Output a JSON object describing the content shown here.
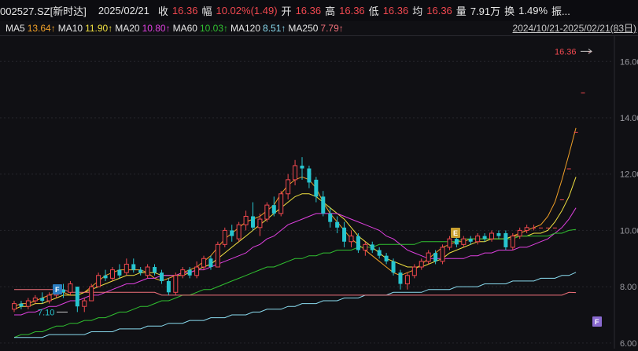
{
  "header": {
    "code": "002527.SZ[新时达]",
    "date": "2025/02/21",
    "close_label": "收",
    "close_value": "16.36",
    "change_label": "幅",
    "change_value": "10.02%(1.49)",
    "open_label": "开",
    "open_value": "16.36",
    "high_label": "高",
    "high_value": "16.36",
    "low_label": "低",
    "low_value": "16.36",
    "avg_label": "均",
    "avg_value": "16.36",
    "vol_label": "量",
    "vol_value": "7.91万",
    "turnover_label": "换",
    "turnover_value": "1.49%",
    "more_label": "振..."
  },
  "ma_legend": [
    {
      "label": "MA5",
      "value": "13.64↑",
      "color": "#f0a028"
    },
    {
      "label": "MA10",
      "value": "11.90↑",
      "color": "#f0e040"
    },
    {
      "label": "MA20",
      "value": "10.80↑",
      "color": "#e040e0"
    },
    {
      "label": "MA60",
      "value": "10.03↑",
      "color": "#30c030"
    },
    {
      "label": "MA120",
      "value": "8.51↑",
      "color": "#8adcf0"
    },
    {
      "label": "MA250",
      "value": "7.79↑",
      "color": "#f0707a"
    }
  ],
  "date_range": "2024/10/21-2025/02/21(83日)",
  "colors": {
    "up": "#f0484f",
    "down": "#27c5cf",
    "grid": "#2a2a30",
    "axis_text": "#9a9aa0"
  },
  "y_axis": {
    "ticks": [
      "16.00",
      "14.00",
      "12.00",
      "10.00",
      "8.00",
      "6.00"
    ],
    "min": 5.8,
    "max": 16.9
  },
  "annotations": {
    "last_price": "16.36",
    "low_price": "7.10",
    "marker_f1": "F",
    "marker_e": "E",
    "marker_f2": "F"
  },
  "chart_data": {
    "type": "candlestick",
    "ylim": [
      5.8,
      16.9
    ],
    "candles": [
      {
        "o": 7.2,
        "c": 7.4,
        "h": 7.5,
        "l": 7.1
      },
      {
        "o": 7.4,
        "c": 7.3,
        "h": 7.5,
        "l": 7.2
      },
      {
        "o": 7.3,
        "c": 7.5,
        "h": 7.6,
        "l": 7.2
      },
      {
        "o": 7.5,
        "c": 7.6,
        "h": 7.7,
        "l": 7.4
      },
      {
        "o": 7.6,
        "c": 7.5,
        "h": 7.8,
        "l": 7.4
      },
      {
        "o": 7.5,
        "c": 7.7,
        "h": 7.8,
        "l": 7.4
      },
      {
        "o": 7.7,
        "c": 7.9,
        "h": 8.0,
        "l": 7.6
      },
      {
        "o": 7.9,
        "c": 7.8,
        "h": 8.1,
        "l": 7.6
      },
      {
        "o": 7.8,
        "c": 8.1,
        "h": 8.2,
        "l": 7.7
      },
      {
        "o": 8.0,
        "c": 7.3,
        "h": 8.0,
        "l": 7.1
      },
      {
        "o": 7.3,
        "c": 7.5,
        "h": 7.6,
        "l": 7.1
      },
      {
        "o": 7.5,
        "c": 8.0,
        "h": 8.1,
        "l": 7.5
      },
      {
        "o": 8.0,
        "c": 8.4,
        "h": 8.5,
        "l": 8.0
      },
      {
        "o": 8.4,
        "c": 8.3,
        "h": 8.6,
        "l": 8.2
      },
      {
        "o": 8.3,
        "c": 8.6,
        "h": 8.7,
        "l": 8.2
      },
      {
        "o": 8.6,
        "c": 8.4,
        "h": 8.8,
        "l": 8.3
      },
      {
        "o": 8.5,
        "c": 8.8,
        "h": 9.0,
        "l": 8.4
      },
      {
        "o": 8.8,
        "c": 8.6,
        "h": 9.0,
        "l": 8.5
      },
      {
        "o": 8.6,
        "c": 8.5,
        "h": 8.7,
        "l": 8.4
      },
      {
        "o": 8.4,
        "c": 8.7,
        "h": 8.8,
        "l": 8.3
      },
      {
        "o": 8.7,
        "c": 8.5,
        "h": 8.8,
        "l": 8.4
      },
      {
        "o": 8.5,
        "c": 8.2,
        "h": 8.6,
        "l": 8.1
      },
      {
        "o": 8.2,
        "c": 7.8,
        "h": 8.3,
        "l": 7.7
      },
      {
        "o": 7.8,
        "c": 8.4,
        "h": 8.5,
        "l": 7.7
      },
      {
        "o": 8.4,
        "c": 8.6,
        "h": 8.7,
        "l": 8.3
      },
      {
        "o": 8.6,
        "c": 8.4,
        "h": 8.7,
        "l": 8.3
      },
      {
        "o": 8.4,
        "c": 8.7,
        "h": 8.9,
        "l": 8.3
      },
      {
        "o": 8.7,
        "c": 9.0,
        "h": 9.1,
        "l": 8.6
      },
      {
        "o": 9.0,
        "c": 8.7,
        "h": 9.1,
        "l": 8.6
      },
      {
        "o": 8.7,
        "c": 9.5,
        "h": 9.6,
        "l": 8.7
      },
      {
        "o": 9.5,
        "c": 10.0,
        "h": 10.1,
        "l": 9.4
      },
      {
        "o": 10.0,
        "c": 9.8,
        "h": 10.2,
        "l": 9.6
      },
      {
        "o": 9.7,
        "c": 10.2,
        "h": 10.3,
        "l": 9.6
      },
      {
        "o": 10.2,
        "c": 10.5,
        "h": 10.7,
        "l": 10.0
      },
      {
        "o": 10.5,
        "c": 10.1,
        "h": 11.0,
        "l": 10.0
      },
      {
        "o": 10.1,
        "c": 10.4,
        "h": 10.6,
        "l": 9.8
      },
      {
        "o": 10.4,
        "c": 10.9,
        "h": 11.0,
        "l": 10.3
      },
      {
        "o": 10.9,
        "c": 10.6,
        "h": 11.2,
        "l": 10.5
      },
      {
        "o": 10.6,
        "c": 11.3,
        "h": 11.4,
        "l": 10.5
      },
      {
        "o": 11.3,
        "c": 11.8,
        "h": 12.0,
        "l": 11.1
      },
      {
        "o": 11.8,
        "c": 12.3,
        "h": 12.5,
        "l": 11.6
      },
      {
        "o": 12.3,
        "c": 12.2,
        "h": 12.6,
        "l": 11.8
      },
      {
        "o": 12.2,
        "c": 11.7,
        "h": 12.3,
        "l": 11.5
      },
      {
        "o": 11.8,
        "c": 11.2,
        "h": 11.9,
        "l": 11.0
      },
      {
        "o": 11.2,
        "c": 10.6,
        "h": 11.4,
        "l": 10.5
      },
      {
        "o": 10.6,
        "c": 10.3,
        "h": 10.8,
        "l": 10.1
      },
      {
        "o": 10.3,
        "c": 10.1,
        "h": 10.5,
        "l": 9.9
      },
      {
        "o": 10.1,
        "c": 9.6,
        "h": 10.3,
        "l": 9.4
      },
      {
        "o": 9.6,
        "c": 9.8,
        "h": 10.0,
        "l": 9.4
      },
      {
        "o": 9.8,
        "c": 9.3,
        "h": 9.9,
        "l": 9.2
      },
      {
        "o": 9.3,
        "c": 9.5,
        "h": 9.6,
        "l": 9.1
      },
      {
        "o": 9.5,
        "c": 9.3,
        "h": 9.6,
        "l": 9.2
      },
      {
        "o": 9.3,
        "c": 9.1,
        "h": 9.4,
        "l": 9.0
      },
      {
        "o": 9.1,
        "c": 8.9,
        "h": 9.2,
        "l": 8.8
      },
      {
        "o": 8.9,
        "c": 8.5,
        "h": 9.0,
        "l": 8.4
      },
      {
        "o": 8.5,
        "c": 8.1,
        "h": 8.6,
        "l": 7.9
      },
      {
        "o": 8.1,
        "c": 8.4,
        "h": 8.5,
        "l": 7.9
      },
      {
        "o": 8.4,
        "c": 8.7,
        "h": 8.8,
        "l": 8.3
      },
      {
        "o": 8.7,
        "c": 8.9,
        "h": 9.0,
        "l": 8.6
      },
      {
        "o": 8.9,
        "c": 9.2,
        "h": 9.3,
        "l": 8.8
      },
      {
        "o": 9.2,
        "c": 8.9,
        "h": 9.3,
        "l": 8.8
      },
      {
        "o": 8.9,
        "c": 9.4,
        "h": 9.5,
        "l": 8.8
      },
      {
        "o": 9.4,
        "c": 9.7,
        "h": 9.8,
        "l": 9.3
      },
      {
        "o": 9.7,
        "c": 9.5,
        "h": 9.8,
        "l": 9.4
      },
      {
        "o": 9.5,
        "c": 9.7,
        "h": 9.8,
        "l": 9.4
      },
      {
        "o": 9.7,
        "c": 9.6,
        "h": 9.8,
        "l": 9.5
      },
      {
        "o": 9.6,
        "c": 9.8,
        "h": 9.9,
        "l": 9.5
      },
      {
        "o": 9.8,
        "c": 9.7,
        "h": 9.9,
        "l": 9.6
      },
      {
        "o": 9.7,
        "c": 9.9,
        "h": 10.0,
        "l": 9.6
      },
      {
        "o": 9.9,
        "c": 9.8,
        "h": 10.0,
        "l": 9.7
      },
      {
        "o": 9.9,
        "c": 9.4,
        "h": 10.0,
        "l": 9.3
      },
      {
        "o": 9.4,
        "c": 9.8,
        "h": 9.9,
        "l": 9.3
      },
      {
        "o": 9.8,
        "c": 10.0,
        "h": 10.1,
        "l": 9.7
      },
      {
        "o": 10.0,
        "c": 10.1,
        "h": 10.2,
        "l": 9.9
      },
      {
        "o": 10.1,
        "c": 10.1,
        "h": 10.2,
        "l": 10.0
      },
      {
        "o": 10.1,
        "c": 10.1,
        "h": 10.1,
        "l": 10.1
      },
      {
        "o": 10.1,
        "c": 10.1,
        "h": 10.1,
        "l": 10.1
      },
      {
        "o": 10.1,
        "c": 10.1,
        "h": 10.1,
        "l": 10.1
      },
      {
        "o": 11.1,
        "c": 11.1,
        "h": 11.1,
        "l": 11.1
      },
      {
        "o": 12.2,
        "c": 12.2,
        "h": 12.2,
        "l": 12.2
      },
      {
        "o": 13.5,
        "c": 13.5,
        "h": 13.5,
        "l": 13.5
      },
      {
        "o": 14.9,
        "c": 14.9,
        "h": 14.9,
        "l": 14.9
      },
      {
        "o": 16.36,
        "c": 16.36,
        "h": 16.36,
        "l": 16.36
      }
    ],
    "ma_lines": {
      "MA5": [
        7.3,
        7.4,
        7.4,
        7.5,
        7.6,
        7.7,
        7.8,
        7.8,
        7.7,
        7.7,
        7.8,
        8.0,
        8.2,
        8.4,
        8.5,
        8.6,
        8.6,
        8.6,
        8.6,
        8.5,
        8.3,
        8.2,
        8.3,
        8.4,
        8.5,
        8.6,
        8.7,
        8.9,
        9.1,
        9.4,
        9.7,
        9.9,
        10.1,
        10.3,
        10.4,
        10.5,
        10.7,
        10.9,
        11.3,
        11.6,
        11.8,
        11.9,
        11.8,
        11.5,
        11.0,
        10.6,
        10.3,
        10.0,
        9.7,
        9.5,
        9.3,
        9.1,
        8.9,
        8.7,
        8.5,
        8.4,
        8.5,
        8.6,
        8.8,
        9.0,
        9.2,
        9.4,
        9.5,
        9.6,
        9.6,
        9.7,
        9.7,
        9.7,
        9.7,
        9.7,
        9.7,
        9.8,
        9.9,
        10.0,
        10.1,
        10.2,
        10.5,
        11.0,
        11.8,
        12.7,
        13.64
      ],
      "MA10": [
        7.2,
        7.3,
        7.3,
        7.4,
        7.4,
        7.5,
        7.6,
        7.7,
        7.7,
        7.7,
        7.8,
        7.9,
        8.0,
        8.1,
        8.2,
        8.3,
        8.4,
        8.4,
        8.5,
        8.5,
        8.5,
        8.4,
        8.4,
        8.4,
        8.4,
        8.5,
        8.6,
        8.7,
        8.8,
        9.0,
        9.2,
        9.4,
        9.6,
        9.8,
        10.0,
        10.2,
        10.4,
        10.6,
        10.8,
        11.0,
        11.2,
        11.3,
        11.3,
        11.2,
        11.0,
        10.8,
        10.6,
        10.4,
        10.1,
        9.8,
        9.6,
        9.4,
        9.2,
        9.0,
        8.9,
        8.8,
        8.7,
        8.7,
        8.7,
        8.8,
        8.9,
        9.0,
        9.2,
        9.3,
        9.4,
        9.5,
        9.6,
        9.6,
        9.7,
        9.7,
        9.7,
        9.8,
        9.8,
        9.8,
        9.9,
        9.9,
        10.0,
        10.3,
        10.7,
        11.2,
        11.9
      ],
      "MA20": [
        7.0,
        7.0,
        7.1,
        7.1,
        7.2,
        7.3,
        7.3,
        7.4,
        7.5,
        7.5,
        7.6,
        7.7,
        7.7,
        7.8,
        7.9,
        8.0,
        8.1,
        8.1,
        8.2,
        8.3,
        8.3,
        8.4,
        8.4,
        8.4,
        8.5,
        8.5,
        8.6,
        8.6,
        8.7,
        8.8,
        8.9,
        9.0,
        9.1,
        9.2,
        9.4,
        9.5,
        9.7,
        9.8,
        10.0,
        10.2,
        10.3,
        10.4,
        10.5,
        10.6,
        10.6,
        10.6,
        10.6,
        10.5,
        10.4,
        10.3,
        10.2,
        10.1,
        10.0,
        9.8,
        9.7,
        9.5,
        9.3,
        9.2,
        9.1,
        9.0,
        9.0,
        9.0,
        9.0,
        9.0,
        9.0,
        9.1,
        9.1,
        9.2,
        9.2,
        9.3,
        9.3,
        9.3,
        9.4,
        9.4,
        9.5,
        9.6,
        9.7,
        9.9,
        10.1,
        10.4,
        10.8
      ],
      "MA60": [
        6.2,
        6.3,
        6.3,
        6.4,
        6.4,
        6.5,
        6.6,
        6.6,
        6.7,
        6.7,
        6.8,
        6.8,
        6.9,
        6.9,
        7.0,
        7.1,
        7.1,
        7.2,
        7.3,
        7.3,
        7.4,
        7.5,
        7.5,
        7.6,
        7.7,
        7.7,
        7.8,
        7.9,
        7.9,
        8.0,
        8.1,
        8.2,
        8.3,
        8.4,
        8.5,
        8.6,
        8.7,
        8.7,
        8.8,
        8.9,
        9.0,
        9.0,
        9.1,
        9.1,
        9.2,
        9.2,
        9.3,
        9.3,
        9.3,
        9.4,
        9.4,
        9.4,
        9.5,
        9.5,
        9.5,
        9.5,
        9.5,
        9.5,
        9.6,
        9.6,
        9.6,
        9.6,
        9.6,
        9.6,
        9.7,
        9.7,
        9.7,
        9.7,
        9.7,
        9.7,
        9.7,
        9.7,
        9.8,
        9.8,
        9.8,
        9.8,
        9.8,
        9.9,
        9.9,
        10.0,
        10.03
      ],
      "MA120": [
        6.2,
        6.2,
        6.2,
        6.2,
        6.2,
        6.3,
        6.3,
        6.3,
        6.3,
        6.3,
        6.3,
        6.4,
        6.4,
        6.4,
        6.4,
        6.5,
        6.5,
        6.5,
        6.5,
        6.6,
        6.6,
        6.6,
        6.7,
        6.7,
        6.7,
        6.8,
        6.8,
        6.8,
        6.9,
        6.9,
        6.9,
        7.0,
        7.0,
        7.0,
        7.1,
        7.1,
        7.2,
        7.2,
        7.2,
        7.3,
        7.3,
        7.4,
        7.4,
        7.4,
        7.5,
        7.5,
        7.5,
        7.6,
        7.6,
        7.6,
        7.7,
        7.7,
        7.7,
        7.7,
        7.8,
        7.8,
        7.8,
        7.8,
        7.8,
        7.9,
        7.9,
        7.9,
        7.9,
        8.0,
        8.0,
        8.0,
        8.0,
        8.1,
        8.1,
        8.1,
        8.1,
        8.2,
        8.2,
        8.2,
        8.2,
        8.3,
        8.3,
        8.3,
        8.4,
        8.4,
        8.51
      ],
      "MA250": [
        7.9,
        7.9,
        7.9,
        7.9,
        7.9,
        7.9,
        7.9,
        7.9,
        7.8,
        7.8,
        7.8,
        7.8,
        7.8,
        7.8,
        7.8,
        7.8,
        7.8,
        7.8,
        7.8,
        7.8,
        7.8,
        7.7,
        7.7,
        7.7,
        7.7,
        7.7,
        7.7,
        7.7,
        7.7,
        7.7,
        7.7,
        7.7,
        7.7,
        7.7,
        7.7,
        7.7,
        7.7,
        7.7,
        7.7,
        7.7,
        7.7,
        7.7,
        7.7,
        7.7,
        7.7,
        7.7,
        7.7,
        7.7,
        7.7,
        7.7,
        7.7,
        7.7,
        7.7,
        7.7,
        7.7,
        7.7,
        7.7,
        7.7,
        7.7,
        7.7,
        7.7,
        7.7,
        7.7,
        7.7,
        7.7,
        7.7,
        7.7,
        7.7,
        7.7,
        7.7,
        7.7,
        7.7,
        7.7,
        7.7,
        7.7,
        7.7,
        7.7,
        7.7,
        7.7,
        7.8,
        7.79
      ]
    }
  }
}
